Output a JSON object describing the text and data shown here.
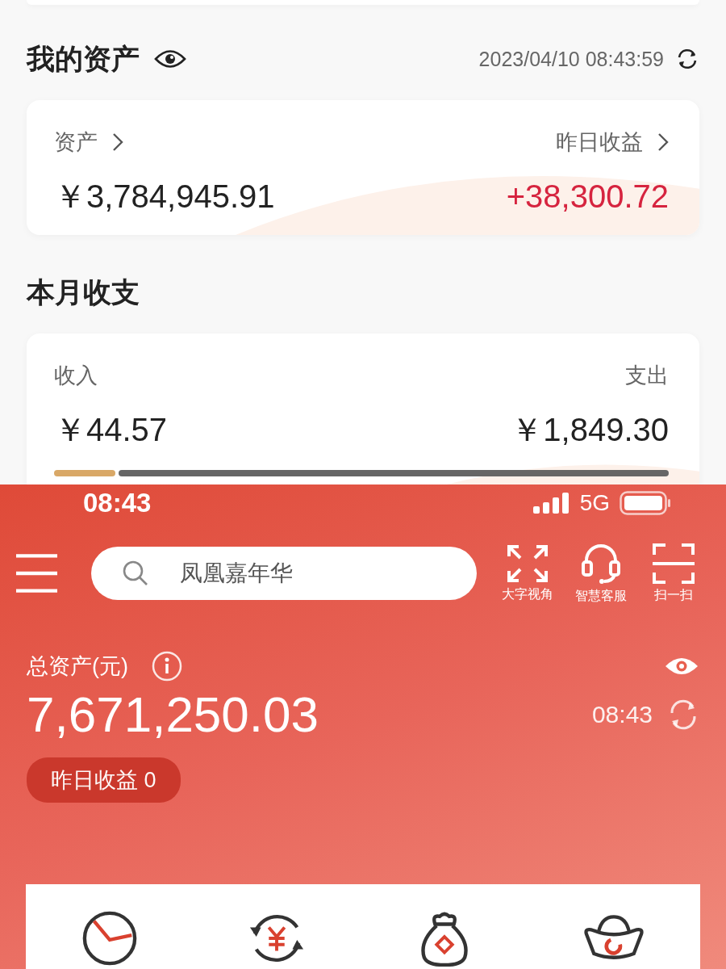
{
  "my_assets": {
    "title": "我的资产",
    "timestamp": "2023/04/10 08:43:59",
    "assets_label": "资产",
    "assets_value": "￥3,784,945.91",
    "yesterday_label": "昨日收益",
    "yesterday_value": "+38,300.72"
  },
  "monthly": {
    "title": "本月收支",
    "income_label": "收入",
    "income_value": "￥44.57",
    "expense_label": "支出",
    "expense_value": "￥1,849.30",
    "level": 0.1
  },
  "status_bar": {
    "time": "08:43",
    "network": "5G"
  },
  "search": {
    "placeholder": "凤凰嘉年华"
  },
  "tools": [
    {
      "kind": "expand",
      "label": "大字视角"
    },
    {
      "kind": "headset",
      "label": "智慧客服"
    },
    {
      "kind": "scan",
      "label": "扫一扫"
    }
  ],
  "total": {
    "label": "总资产(元)",
    "value": "7,671,250.03",
    "time": "08:43",
    "yesterday": "昨日收益 0"
  },
  "shortcuts": [
    {
      "kind": "clock"
    },
    {
      "kind": "exchange"
    },
    {
      "kind": "bag"
    },
    {
      "kind": "ingot"
    }
  ]
}
